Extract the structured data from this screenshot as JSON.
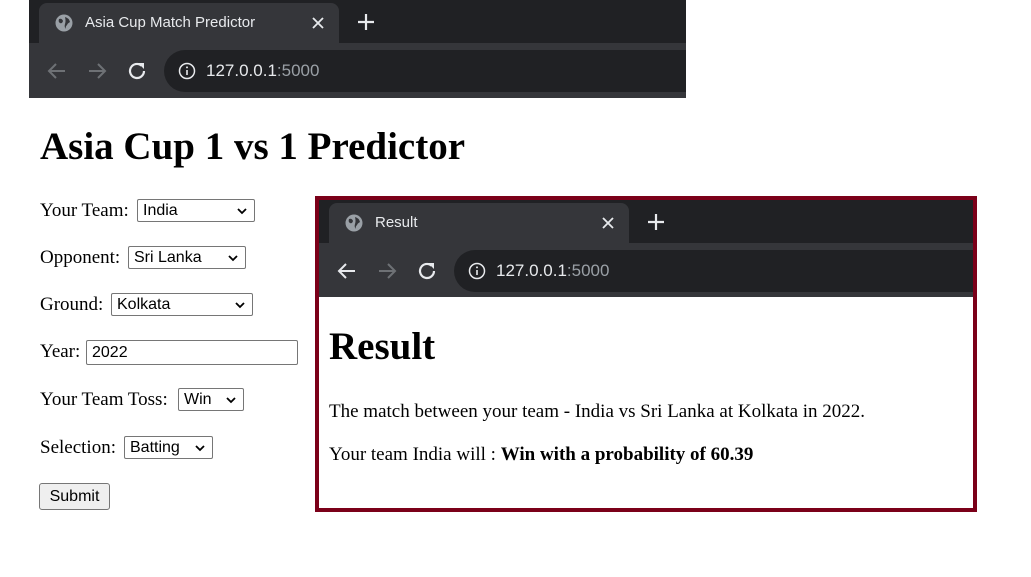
{
  "main_window": {
    "tab_title": "Asia Cup Match Predictor",
    "url_host": "127.0.0.1",
    "url_port": ":5000"
  },
  "page": {
    "title": "Asia Cup 1 vs 1 Predictor",
    "form": {
      "your_team_label": "Your Team:",
      "your_team_value": "India",
      "opponent_label": "Opponent:",
      "opponent_value": "Sri Lanka",
      "ground_label": "Ground:",
      "ground_value": "Kolkata",
      "year_label": "Year:",
      "year_value": "2022",
      "toss_label": "Your Team Toss:",
      "toss_value": "Win",
      "selection_label": "Selection:",
      "selection_value": "Batting",
      "submit_label": "Submit"
    }
  },
  "result_window": {
    "tab_title": "Result",
    "url_host": "127.0.0.1",
    "url_port": ":5000",
    "heading": "Result",
    "match_text": "The match between your team - India vs Sri Lanka at Kolkata in 2022.",
    "outcome_prefix": "Your team India will : ",
    "outcome_value": "Win with a probability of 60.39"
  },
  "colors": {
    "chrome_dark": "#202124",
    "chrome_tab": "#35363a",
    "result_border": "#7b0019"
  },
  "icons": [
    "globe-icon",
    "close-icon",
    "new-tab-icon",
    "back-icon",
    "forward-icon",
    "reload-icon",
    "info-icon",
    "chevron-down-icon"
  ]
}
